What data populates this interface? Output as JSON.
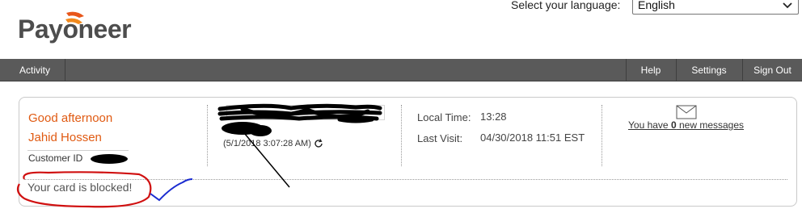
{
  "brand": {
    "logo_text": "Payoneer",
    "logo_mark_registered": "®"
  },
  "language": {
    "label": "Select your language:",
    "selected": "English"
  },
  "nav": {
    "activity": "Activity",
    "help": "Help",
    "settings": "Settings",
    "sign_out": "Sign Out"
  },
  "welcome": {
    "greeting": "Good afternoon",
    "name": "Jahid Hossen",
    "customer_id_label": "Customer ID",
    "last_login": "(5/1/2018 3:07:28 AM)",
    "local_time_label": "Local Time:",
    "local_time_value": "13:28",
    "last_visit_label": "Last Visit:",
    "last_visit_value": "04/30/2018 11:51 EST",
    "messages_prefix": "You have ",
    "messages_count": "0",
    "messages_suffix": " new messages",
    "card_status": "Your card is blocked!"
  },
  "colors": {
    "brand_orange": "#e05a12",
    "nav_bg": "#5a5a5a",
    "annotation_red": "#d01010",
    "annotation_blue": "#1a2bd0"
  }
}
